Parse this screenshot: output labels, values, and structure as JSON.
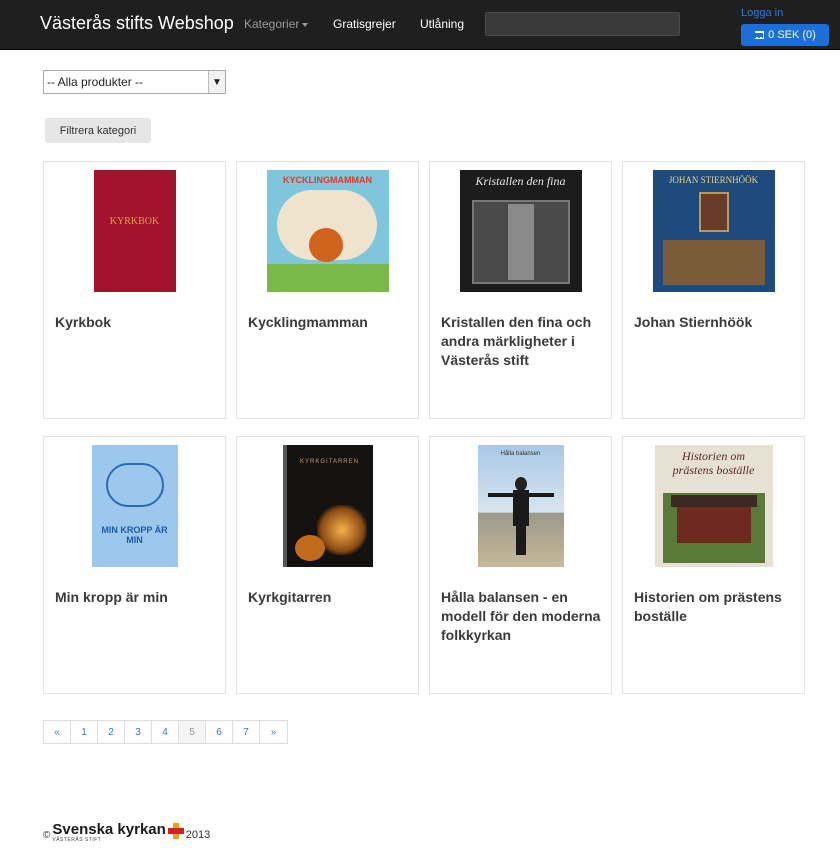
{
  "navbar": {
    "brand": "Västerås stifts Webshop",
    "links": [
      "Kategorier",
      "Gratisgrejer",
      "Utlåning"
    ],
    "search_placeholder": "",
    "login": "Logga in",
    "cart": "0 SEK (0)"
  },
  "filter": {
    "selected": "-- Alla produkter --",
    "button": "Filtrera kategori"
  },
  "products": [
    {
      "title": "Kyrkbok"
    },
    {
      "title": "Kycklingmamman",
      "cover_text": "KYCKLINGMAMMAN"
    },
    {
      "title": "Kristallen den fina och andra märkligheter i Västerås stift",
      "cover_text": "Kristallen den fina"
    },
    {
      "title": "Johan Stiernhöök",
      "cover_text": "JOHAN STIERNHÖÖK"
    },
    {
      "title": "Min kropp är min",
      "cover_text": "MIN KROPP ÄR MIN"
    },
    {
      "title": "Kyrkgitarren",
      "cover_text": "KYRKGITARREN"
    },
    {
      "title": "Hålla balansen - en modell för den moderna folkkyrkan",
      "cover_text": "Hålla balansen"
    },
    {
      "title": "Historien om prästens boställe",
      "cover_text": "Historien om prästens boställe"
    }
  ],
  "cover_1_text": "KYRKBOK",
  "pagination": [
    "«",
    "1",
    "2",
    "3",
    "4",
    "5",
    "6",
    "7",
    "»"
  ],
  "pagination_active": "5",
  "footer": {
    "copy": "©",
    "logo": "Svenska kyrkan",
    "logo_sub": "VÄSTERÅS STIFT",
    "year": "2013"
  }
}
